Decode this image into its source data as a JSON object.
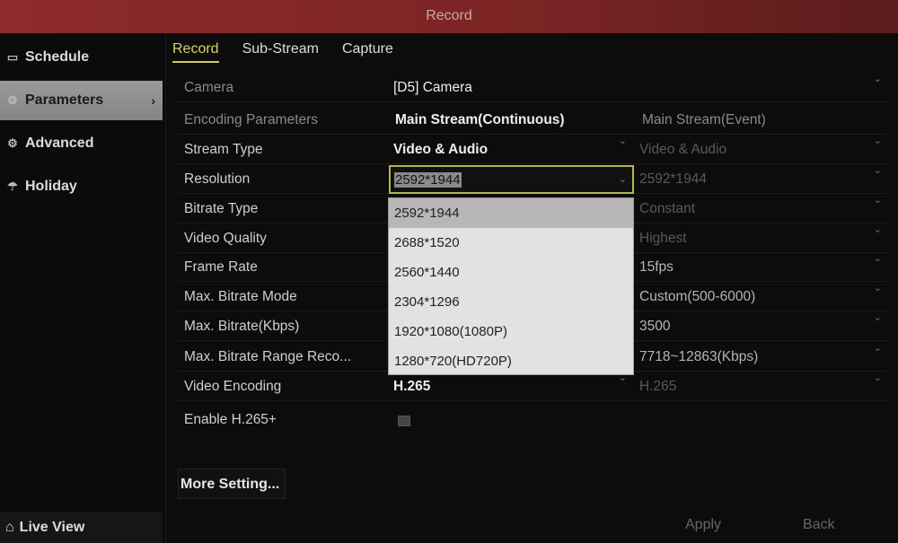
{
  "window": {
    "title": "Record"
  },
  "sidebar": {
    "items": [
      {
        "label": "Schedule",
        "icon": "calendar-icon"
      },
      {
        "label": "Parameters",
        "icon": "gear-icon",
        "active": true
      },
      {
        "label": "Advanced",
        "icon": "gears-icon"
      },
      {
        "label": "Holiday",
        "icon": "umbrella-icon"
      }
    ],
    "live_view": "Live View"
  },
  "tabs": [
    {
      "label": "Record",
      "active": true
    },
    {
      "label": "Sub-Stream"
    },
    {
      "label": "Capture"
    }
  ],
  "form": {
    "camera": {
      "label": "Camera",
      "value": "[D5] Camera"
    },
    "encoding": {
      "label": "Encoding Parameters",
      "col1": "Main Stream(Continuous)",
      "col2": "Main Stream(Event)"
    },
    "rows": [
      {
        "label": "Stream Type",
        "v1": "Video & Audio",
        "v2": "Video & Audio"
      },
      {
        "label": "Resolution",
        "v1": "2592*1944",
        "v2": "2592*1944"
      },
      {
        "label": "Bitrate Type",
        "v2": "Constant"
      },
      {
        "label": "Video Quality",
        "v2": "Highest"
      },
      {
        "label": "Frame Rate",
        "v2": "15fps"
      },
      {
        "label": "Max. Bitrate Mode",
        "v2": "Custom(500-6000)"
      },
      {
        "label": "Max. Bitrate(Kbps)",
        "v2": "3500"
      },
      {
        "label": "Max. Bitrate Range Reco...",
        "v2": "7718~12863(Kbps)"
      },
      {
        "label": "Video Encoding",
        "v1": "H.265",
        "v2": "H.265"
      }
    ],
    "enable_h265plus": {
      "label": "Enable H.265+",
      "checked": false
    }
  },
  "resolution_dropdown": {
    "selected": "2592*1944",
    "options": [
      "2592*1944",
      "2688*1520",
      "2560*1440",
      "2304*1296",
      "1920*1080(1080P)",
      "1280*720(HD720P)"
    ]
  },
  "buttons": {
    "more": "More Setting...",
    "apply": "Apply",
    "back": "Back"
  }
}
